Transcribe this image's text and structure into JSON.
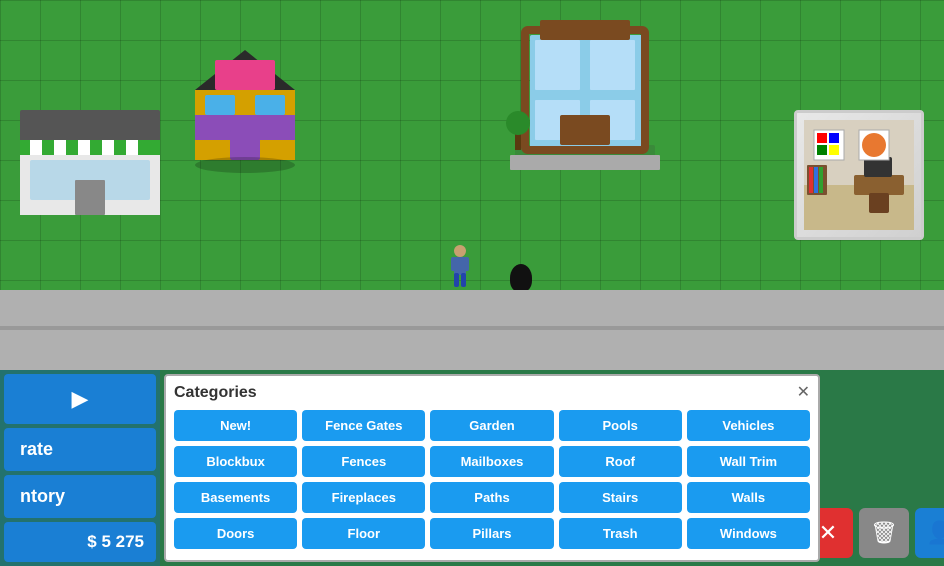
{
  "game": {
    "currency": "$ 5 275",
    "preview_label": "room preview"
  },
  "sidebar": {
    "buttons": [
      {
        "id": "rate",
        "label": "rate",
        "show": "rate"
      },
      {
        "id": "inventory",
        "label": "ntory",
        "show": "ntory"
      }
    ],
    "cursor_hint": "▶"
  },
  "categories": {
    "title": "Categories",
    "close_label": "✕",
    "items": [
      {
        "id": "new",
        "label": "New!"
      },
      {
        "id": "fence-gates",
        "label": "Fence Gates"
      },
      {
        "id": "garden",
        "label": "Garden"
      },
      {
        "id": "pools",
        "label": "Pools"
      },
      {
        "id": "vehicles",
        "label": "Vehicles"
      },
      {
        "id": "blockbux",
        "label": "Blockbux"
      },
      {
        "id": "fences",
        "label": "Fences"
      },
      {
        "id": "mailboxes",
        "label": "Mailboxes"
      },
      {
        "id": "roof",
        "label": "Roof"
      },
      {
        "id": "wall-trim",
        "label": "Wall Trim"
      },
      {
        "id": "basements",
        "label": "Basements"
      },
      {
        "id": "fireplaces",
        "label": "Fireplaces"
      },
      {
        "id": "paths",
        "label": "Paths"
      },
      {
        "id": "stairs",
        "label": "Stairs"
      },
      {
        "id": "walls",
        "label": "Walls"
      },
      {
        "id": "doors",
        "label": "Doors"
      },
      {
        "id": "floor",
        "label": "Floor"
      },
      {
        "id": "pillars",
        "label": "Pillars"
      },
      {
        "id": "trash",
        "label": "Trash"
      },
      {
        "id": "windows",
        "label": "Windows"
      }
    ]
  },
  "action_buttons": {
    "delete_label": "✕",
    "trash_label": "🗑",
    "person_label": "👤"
  }
}
